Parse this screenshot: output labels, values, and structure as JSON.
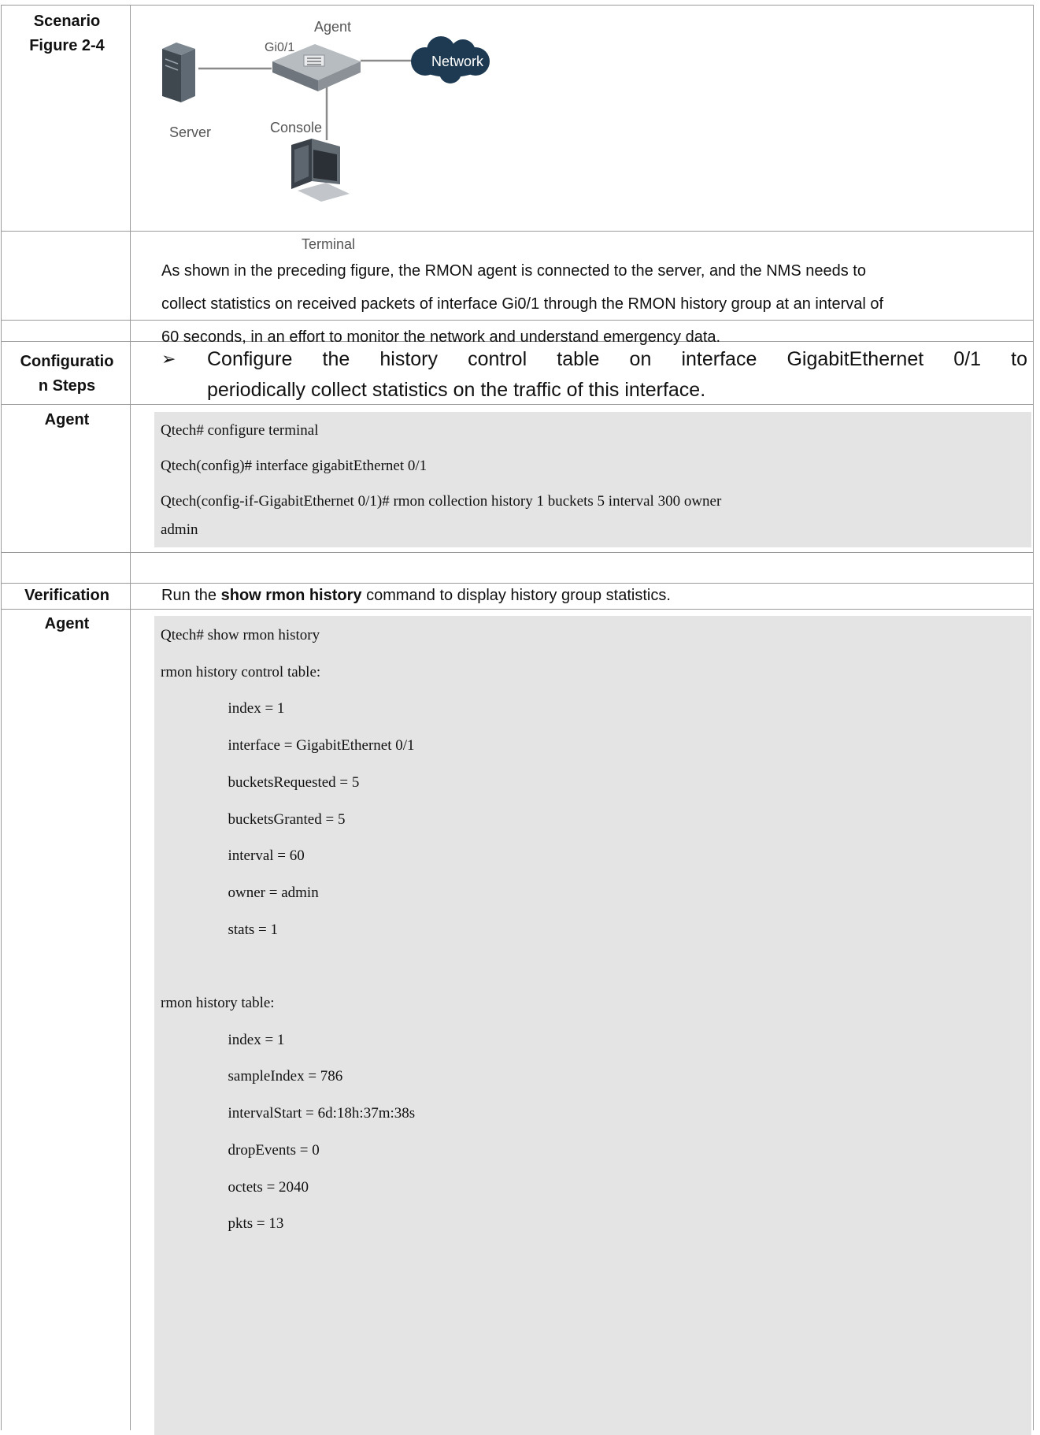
{
  "rows": {
    "scenario_label": "Scenario",
    "figure_label": "Figure 2-4",
    "config_label_1": "Configuratio",
    "config_label_2": "n Steps",
    "agent_label_1": "Agent",
    "verification_label": "Verification",
    "agent_label_2": "Agent"
  },
  "diagram": {
    "agent": "Agent",
    "port": "Gi0/1",
    "network": "Network",
    "server": "Server",
    "console": "Console",
    "terminal": "Terminal"
  },
  "description": [
    "As shown in the preceding figure, the RMON agent is connected to the server, and the NMS needs to",
    "collect statistics on received packets of interface Gi0/1 through the RMON history group at an interval of",
    "60 seconds, in an effort to monitor the network and understand emergency data."
  ],
  "config_steps": {
    "bullet": "➢",
    "line1": "Configure the history control table on interface GigabitEthernet 0/1 to",
    "line2": "periodically collect statistics on the traffic of this interface."
  },
  "config_code": [
    "Qtech# configure terminal",
    "Qtech(config)# interface gigabitEthernet 0/1",
    "Qtech(config-if-GigabitEthernet 0/1)# rmon collection history 1 buckets 5 interval 300 owner",
    "admin"
  ],
  "verification": {
    "prefix": "Run the ",
    "command": "show rmon history",
    "suffix": " command to display history group statistics."
  },
  "verify_code": [
    "Qtech# show rmon history",
    "rmon history control table:",
    "                  index = 1",
    "                  interface = GigabitEthernet 0/1",
    "                  bucketsRequested = 5",
    "                  bucketsGranted = 5",
    "                  interval = 60",
    "                  owner = admin",
    "                  stats = 1",
    "",
    "rmon history table:",
    "                  index = 1",
    "                  sampleIndex = 786",
    "                  intervalStart = 6d:18h:37m:38s",
    "                  dropEvents = 0",
    "                  octets = 2040",
    "                  pkts = 13"
  ]
}
